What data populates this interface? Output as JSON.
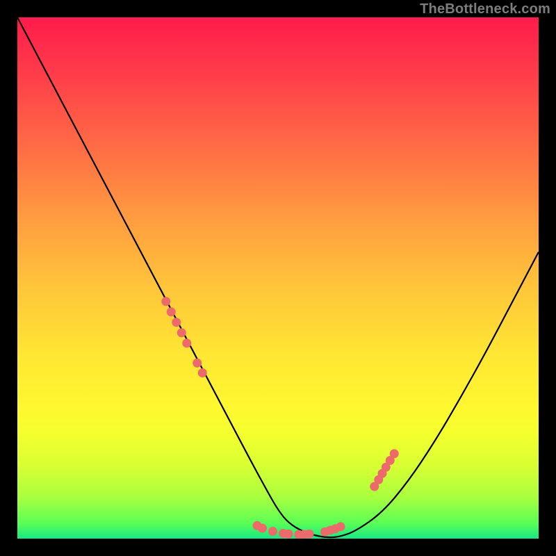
{
  "watermark": {
    "text": "TheBottleneck.com"
  },
  "colors": {
    "page_bg": "#000000",
    "curve_stroke": "#000000",
    "marker_fill": "#ed6a6b",
    "marker_stroke": "#ed6a6b",
    "gradient_top": "#ff1b4b",
    "gradient_bottom": "#16e884"
  },
  "chart_data": {
    "type": "line",
    "title": "",
    "xlabel": "",
    "ylabel": "",
    "xlim": [
      0,
      100
    ],
    "ylim": [
      0,
      100
    ],
    "grid": false,
    "legend": false,
    "series": [
      {
        "name": "bottleneck-curve",
        "x": [
          0,
          5,
          10,
          15,
          20,
          25,
          30,
          35,
          40,
          45,
          48,
          50,
          52,
          55,
          58,
          60,
          62,
          65,
          70,
          75,
          80,
          85,
          90,
          95,
          100
        ],
        "values": [
          100,
          90.5,
          81,
          71.5,
          62,
          52.5,
          43,
          33.5,
          24,
          14.5,
          9,
          5.5,
          3,
          1.2,
          0.4,
          0.2,
          0.4,
          1.5,
          5,
          11,
          18.5,
          27,
          36,
          45.5,
          55
        ]
      }
    ],
    "markers": [
      {
        "x": 28.5,
        "y": 45.5
      },
      {
        "x": 29.5,
        "y": 43.5
      },
      {
        "x": 30.5,
        "y": 41.5
      },
      {
        "x": 31.5,
        "y": 39.5
      },
      {
        "x": 32.5,
        "y": 37.5
      },
      {
        "x": 34.5,
        "y": 33.7
      },
      {
        "x": 35.5,
        "y": 31.8
      },
      {
        "x": 46,
        "y": 2.5
      },
      {
        "x": 47,
        "y": 2.0
      },
      {
        "x": 49,
        "y": 1.4
      },
      {
        "x": 51,
        "y": 1.0
      },
      {
        "x": 52,
        "y": 0.9
      },
      {
        "x": 54,
        "y": 0.8
      },
      {
        "x": 55,
        "y": 0.8
      },
      {
        "x": 56,
        "y": 0.9
      },
      {
        "x": 59,
        "y": 1.3
      },
      {
        "x": 60,
        "y": 1.6
      },
      {
        "x": 61,
        "y": 1.9
      },
      {
        "x": 62,
        "y": 2.3
      },
      {
        "x": 68.5,
        "y": 10.0
      },
      {
        "x": 69.3,
        "y": 11.3
      },
      {
        "x": 70.0,
        "y": 12.5
      },
      {
        "x": 70.7,
        "y": 13.7
      },
      {
        "x": 71.5,
        "y": 15.0
      },
      {
        "x": 72.3,
        "y": 16.3
      }
    ]
  }
}
